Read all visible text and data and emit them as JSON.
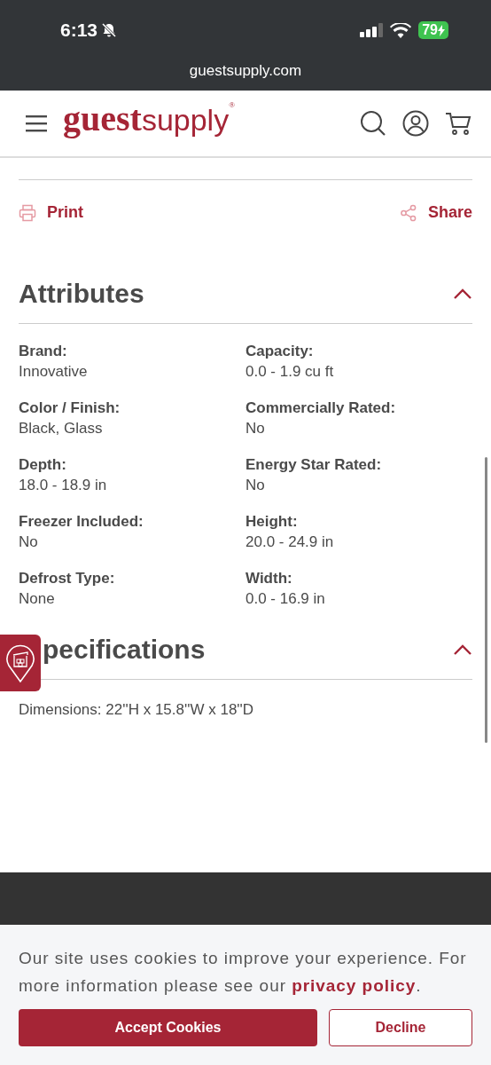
{
  "status_bar": {
    "time": "6:13",
    "battery": "79"
  },
  "browser": {
    "url": "guestsupply.com"
  },
  "header": {
    "logo_bold": "guest",
    "logo_light": "supply",
    "logo_mark": "®"
  },
  "actions": [
    {
      "kind": "print",
      "label": "Print"
    },
    {
      "kind": "share",
      "label": "Share"
    }
  ],
  "sections": [
    {
      "title": "Attributes",
      "expanded": true,
      "attributes": [
        {
          "label": "Brand:",
          "value": "Innovative"
        },
        {
          "label": "Capacity:",
          "value": "0.0 - 1.9 cu ft"
        },
        {
          "label": "Color / Finish:",
          "value": "Black, Glass"
        },
        {
          "label": "Commercially Rated:",
          "value": "No"
        },
        {
          "label": "Depth:",
          "value": "18.0 - 18.9 in"
        },
        {
          "label": "Energy Star Rated:",
          "value": "No"
        },
        {
          "label": "Freezer Included:",
          "value": "No"
        },
        {
          "label": "Height:",
          "value": "20.0 - 24.9 in"
        },
        {
          "label": "Defrost Type:",
          "value": "None"
        },
        {
          "label": "Width:",
          "value": "0.0 - 16.9 in"
        }
      ]
    },
    {
      "title": "pecifications",
      "covered_start": true,
      "expanded": true,
      "text": "Dimensions: 22''H x 15.8''W x 18''D"
    }
  ],
  "cookie_banner": {
    "text_before": "Our site uses cookies to improve your experience. For more information please see our ",
    "link": "privacy policy",
    "text_after": ".",
    "accept": "Accept Cookies",
    "decline": "Decline"
  }
}
